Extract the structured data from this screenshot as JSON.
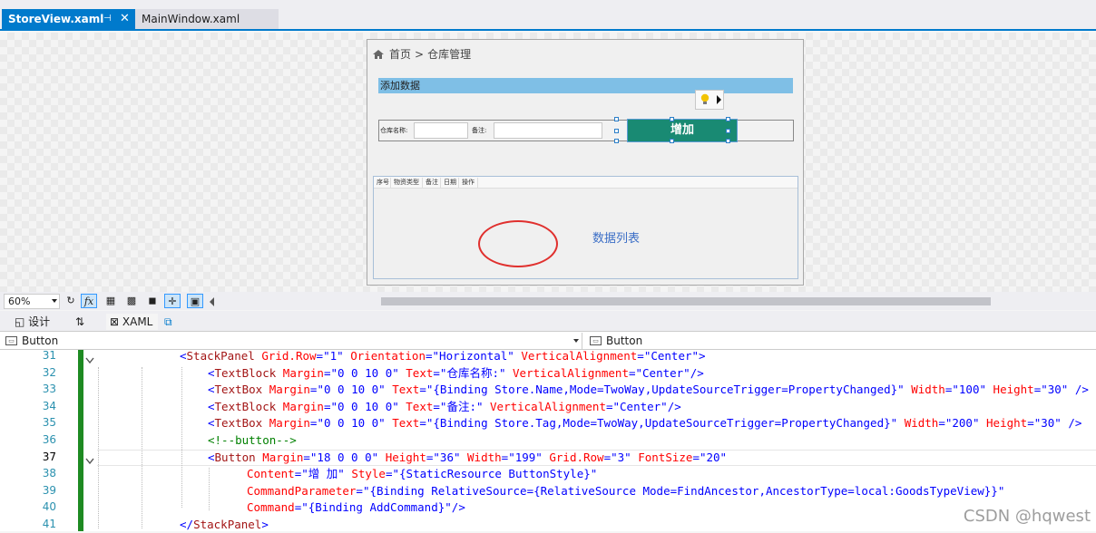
{
  "tabs": [
    {
      "label": "StoreView.xaml",
      "active": true
    },
    {
      "label": "MainWindow.xaml",
      "active": false
    }
  ],
  "designer": {
    "breadcrumb": {
      "home": "首页",
      "separator": ">",
      "current": "仓库管理"
    },
    "add_header": "添加数据",
    "form": {
      "name_label": "仓库名称:",
      "remark_label": "备注:",
      "add_button": "增加"
    },
    "grid": {
      "columns": [
        "序号",
        "物资类型",
        "备注",
        "日期",
        "操作"
      ],
      "title": "数据列表"
    }
  },
  "design_toolbar": {
    "zoom": "60%",
    "fx_label": "fx"
  },
  "split_tabs": {
    "design": "设计",
    "swap": "⇅",
    "xaml": "XAML"
  },
  "selectors": {
    "left": "Button",
    "right": "Button"
  },
  "editor": {
    "lines": [
      {
        "n": "31",
        "indent": 1,
        "text": "<StackPanel Grid.Row=\"1\" Orientation=\"Horizontal\" VerticalAlignment=\"Center\">"
      },
      {
        "n": "32",
        "indent": 2,
        "text": "<TextBlock Margin=\"0 0 10 0\" Text=\"仓库名称:\" VerticalAlignment=\"Center\"/>"
      },
      {
        "n": "33",
        "indent": 2,
        "text": "<TextBox Margin=\"0 0 10 0\" Text=\"{Binding Store.Name,Mode=TwoWay,UpdateSourceTrigger=PropertyChanged}\" Width=\"100\" Height=\"30\" />"
      },
      {
        "n": "34",
        "indent": 2,
        "text": "<TextBlock Margin=\"0 0 10 0\" Text=\"备注:\" VerticalAlignment=\"Center\"/>"
      },
      {
        "n": "35",
        "indent": 2,
        "text": "<TextBox Margin=\"0 0 10 0\" Text=\"{Binding Store.Tag,Mode=TwoWay,UpdateSourceTrigger=PropertyChanged}\" Width=\"200\" Height=\"30\" />"
      },
      {
        "n": "36",
        "indent": 2,
        "text": "<!--button-->"
      },
      {
        "n": "37",
        "indent": 2,
        "text": "<Button Margin=\"18 0 0 0\" Height=\"36\" Width=\"199\" Grid.Row=\"3\" FontSize=\"20\""
      },
      {
        "n": "38",
        "indent": 3,
        "text": "Content=\"增 加\" Style=\"{StaticResource ButtonStyle}\""
      },
      {
        "n": "39",
        "indent": 3,
        "text": "CommandParameter=\"{Binding RelativeSource={RelativeSource Mode=FindAncestor,AncestorType=local:GoodsTypeView}}\""
      },
      {
        "n": "40",
        "indent": 3,
        "text": "Command=\"{Binding AddCommand}\"/>"
      },
      {
        "n": "41",
        "indent": 1,
        "text": "</StackPanel>"
      }
    ],
    "current_line": "37"
  },
  "watermark": "CSDN @hqwest",
  "colors": {
    "accent": "#007acc",
    "add_button": "#198a73",
    "add_header": "#7fbfe6",
    "change_bar": "#1e8a22",
    "annotation_circle": "#e0302e"
  }
}
